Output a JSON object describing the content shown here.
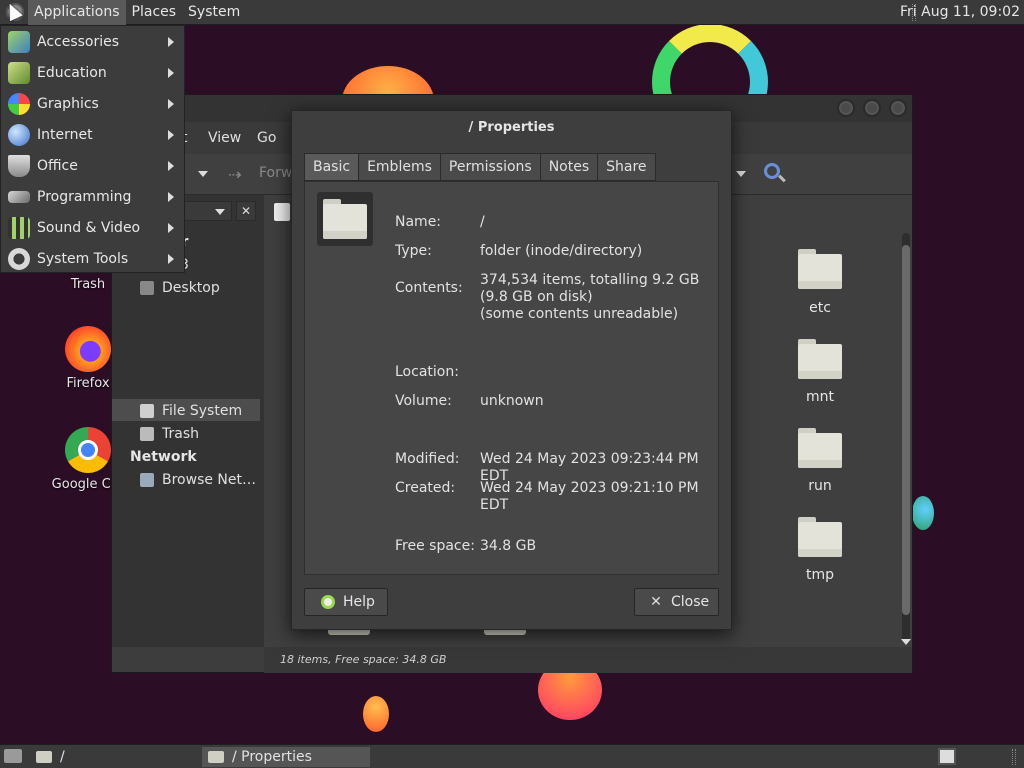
{
  "top_panel": {
    "menus": [
      "Applications",
      "Places",
      "System"
    ],
    "clock": "Fri Aug 11, 09:02"
  },
  "apps_menu": {
    "items": [
      {
        "label": "Accessories",
        "icon": "accessories-icon"
      },
      {
        "label": "Education",
        "icon": "education-icon"
      },
      {
        "label": "Graphics",
        "icon": "graphics-icon"
      },
      {
        "label": "Internet",
        "icon": "internet-icon"
      },
      {
        "label": "Office",
        "icon": "office-icon"
      },
      {
        "label": "Programming",
        "icon": "programming-icon"
      },
      {
        "label": "Sound & Video",
        "icon": "sound-video-icon"
      },
      {
        "label": "System Tools",
        "icon": "system-tools-icon"
      }
    ]
  },
  "desktop_icons": {
    "trash": "Trash",
    "firefox": "Firefox",
    "chrome": "Google Chr"
  },
  "file_manager": {
    "menu_fragment": "t",
    "menus": [
      "View",
      "Go"
    ],
    "forward_label": "Forw",
    "sidebar": {
      "heading_fragment": "er",
      "home_fragment": "3",
      "items": [
        "Desktop",
        "File System",
        "Trash"
      ],
      "network_heading": "Network",
      "network_items": [
        "Browse Net…"
      ]
    },
    "folders": [
      "etc",
      "mnt",
      "run",
      "tmp"
    ],
    "status": "18 items, Free space: 34.8 GB"
  },
  "properties": {
    "title": "/ Properties",
    "tabs": [
      "Basic",
      "Emblems",
      "Permissions",
      "Notes",
      "Share"
    ],
    "active_tab": "Basic",
    "fields": {
      "name_label": "Name:",
      "name_value": "/",
      "type_label": "Type:",
      "type_value": "folder (inode/directory)",
      "contents_label": "Contents:",
      "contents_line1": "374,534 items, totalling 9.2 GB",
      "contents_line2": "(9.8 GB on disk)",
      "contents_line3": "(some contents unreadable)",
      "location_label": "Location:",
      "volume_label": "Volume:",
      "volume_value": "unknown",
      "modified_label": "Modified:",
      "modified_value": "Wed 24 May 2023 09:23:44 PM EDT",
      "created_label": "Created:",
      "created_value": "Wed 24 May 2023 09:21:10 PM EDT",
      "free_label": "Free space:",
      "free_value": "34.8 GB"
    },
    "help_button": "Help",
    "close_button": "Close"
  },
  "taskbar": {
    "items": [
      "/",
      "/ Properties"
    ]
  },
  "colors": {
    "desktop_bg": "#2c0d26",
    "panel_bg": "#3a3a3a",
    "accent_orange": "#ff7a3d",
    "accent_green": "#6fdc5f"
  }
}
